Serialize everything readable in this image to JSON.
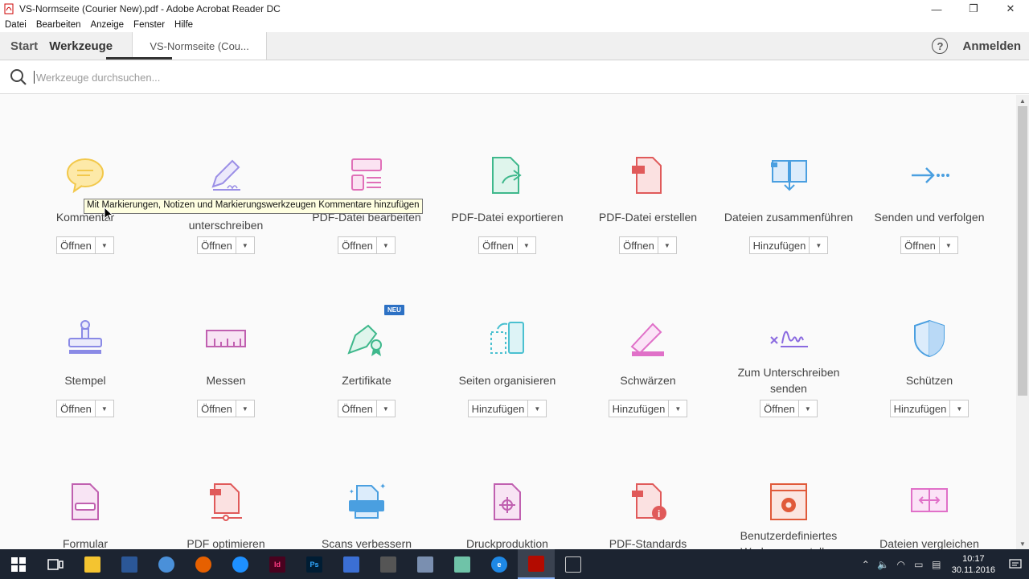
{
  "window": {
    "title": "VS-Normseite (Courier New).pdf - Adobe Acrobat Reader DC",
    "minimize": "—",
    "restore": "❐",
    "close": "✕"
  },
  "menu": [
    "Datei",
    "Bearbeiten",
    "Anzeige",
    "Fenster",
    "Hilfe"
  ],
  "tabs": {
    "start": "Start",
    "tools": "Werkzeuge",
    "document": "VS-Normseite (Cou...",
    "help": "?",
    "signin": "Anmelden"
  },
  "search": {
    "placeholder": "Werkzeuge durchsuchen..."
  },
  "tooltip": "Mit Markierungen, Notizen und Markierungswerkzeugen Kommentare hinzufügen",
  "badge_new": "NEU",
  "tools": [
    {
      "label": "Kommentar",
      "button": "Öffnen",
      "icon": "comment-icon",
      "color": "#f5c542"
    },
    {
      "label": "Ausfüllen und unterschreiben",
      "button": "Öffnen",
      "icon": "fill-sign-icon",
      "color": "#9b8fe6"
    },
    {
      "label": "PDF-Datei bearbeiten",
      "button": "Öffnen",
      "icon": "edit-pdf-icon",
      "color": "#e070b8"
    },
    {
      "label": "PDF-Datei exportieren",
      "button": "Öffnen",
      "icon": "export-pdf-icon",
      "color": "#3fb88c"
    },
    {
      "label": "PDF-Datei erstellen",
      "button": "Öffnen",
      "icon": "create-pdf-icon",
      "color": "#e05a5a"
    },
    {
      "label": "Dateien zusammenführen",
      "button": "Hinzufügen",
      "icon": "combine-files-icon",
      "color": "#4a9fe0"
    },
    {
      "label": "Senden und verfolgen",
      "button": "Öffnen",
      "icon": "send-track-icon",
      "color": "#4a9fe0"
    },
    {
      "label": "Stempel",
      "button": "Öffnen",
      "icon": "stamp-icon",
      "color": "#8a8ae6"
    },
    {
      "label": "Messen",
      "button": "Öffnen",
      "icon": "measure-icon",
      "color": "#c060b0"
    },
    {
      "label": "Zertifikate",
      "button": "Öffnen",
      "icon": "certificate-icon",
      "color": "#3fb88c"
    },
    {
      "label": "Seiten organisieren",
      "button": "Hinzufügen",
      "icon": "organize-pages-icon",
      "color": "#4ac0d0"
    },
    {
      "label": "Schwärzen",
      "button": "Hinzufügen",
      "icon": "redact-icon",
      "color": "#e070c8"
    },
    {
      "label": "Zum Unterschreiben senden",
      "button": "Öffnen",
      "icon": "send-for-signature-icon",
      "color": "#8a6ae0"
    },
    {
      "label": "Schützen",
      "button": "Hinzufügen",
      "icon": "protect-icon",
      "color": "#4a9fe0"
    },
    {
      "label": "Formular",
      "button": "",
      "icon": "form-icon",
      "color": "#c060b0"
    },
    {
      "label": "PDF optimieren",
      "button": "",
      "icon": "optimize-pdf-icon",
      "color": "#e05a5a"
    },
    {
      "label": "Scans verbessern",
      "button": "",
      "icon": "enhance-scans-icon",
      "color": "#4a9fe0"
    },
    {
      "label": "Druckproduktion",
      "button": "",
      "icon": "print-production-icon",
      "color": "#c060b0"
    },
    {
      "label": "PDF-Standards",
      "button": "",
      "icon": "pdf-standards-icon",
      "color": "#e05a5a"
    },
    {
      "label": "Benutzerdefiniertes Werkzeug erstellen",
      "button": "",
      "icon": "custom-tool-icon",
      "color": "#e05a3a"
    },
    {
      "label": "Dateien vergleichen",
      "button": "",
      "icon": "compare-files-icon",
      "color": "#e070c8"
    }
  ],
  "taskbar": {
    "apps": [
      "start",
      "task-view",
      "file-explorer",
      "app-2",
      "app-3",
      "firefox",
      "app-5",
      "indesign",
      "photoshop",
      "app-8",
      "calculator",
      "app-10",
      "app-11",
      "edge",
      "acrobat",
      "app-15"
    ],
    "time": "10:17",
    "date": "30.11.2016"
  }
}
